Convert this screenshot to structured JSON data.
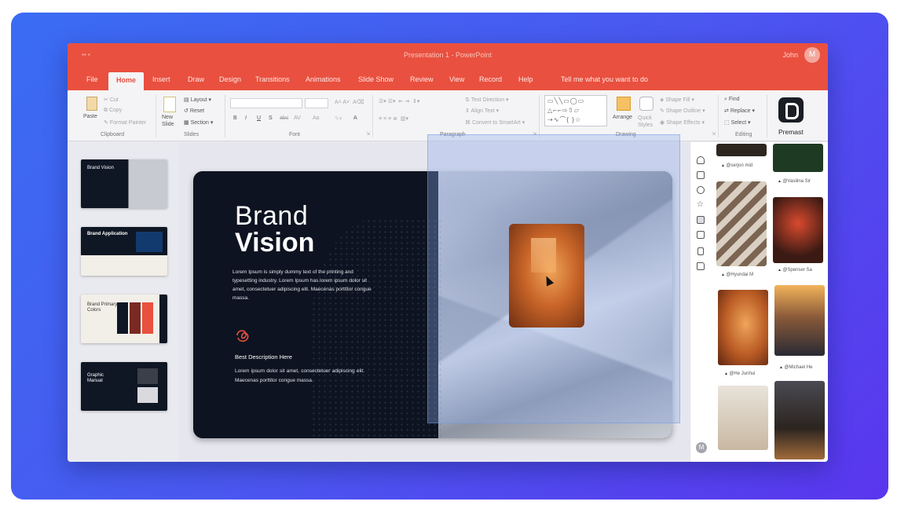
{
  "window": {
    "title": "Presentation 1 - PowerPoint",
    "user": "John",
    "user_initial": "M",
    "quick_access": "▪▪ ▪"
  },
  "tabs": [
    "File",
    "Home",
    "Insert",
    "Draw",
    "Design",
    "Transitions",
    "Animations",
    "Slide Show",
    "Review",
    "View",
    "Record",
    "Help",
    "Tell me what you want to do"
  ],
  "ribbon": {
    "clipboard": {
      "paste": "Paste",
      "cut": "Cut",
      "copy": "Copy",
      "format_painter": "Format Painter",
      "label": "Clipboard"
    },
    "slides": {
      "new_slide": "New Slide",
      "layout": "Layout",
      "reset": "Reset",
      "section": "Section",
      "label": "Slides"
    },
    "font": {
      "label": "Font",
      "buttons": [
        "B",
        "I",
        "U",
        "S",
        "abc",
        "AV",
        "Aa",
        "A"
      ]
    },
    "paragraph": {
      "label": "Paragraph",
      "text_direction": "Text Direction",
      "align_text": "Align Text",
      "smartart": "Convert to SmartArt"
    },
    "drawing": {
      "label": "Drawing",
      "arrange": "Arrange",
      "quick_styles": "Quick Styles",
      "shape_fill": "Shape Fill",
      "shape_outline": "Shape Outline",
      "shape_effects": "Shape Effects",
      "shapes_glyphs": "▭╲╲▭◯▭ △⌐⌐⇨⇧▱ ⇢∿⌒{ }☆"
    },
    "editing": {
      "label": "Editing",
      "find": "Find",
      "replace": "Replace",
      "select": "Select"
    },
    "addin": {
      "label": "Premast"
    }
  },
  "thumbnails": [
    {
      "title": "Brand Vision",
      "bg": "#0f1624"
    },
    {
      "title": "Brand Application",
      "bg": "#f2efe8"
    },
    {
      "title": "Brand Primary Colors",
      "bg": "#f2efe8"
    },
    {
      "title": "Graphic Manual",
      "bg": "#0f1624"
    }
  ],
  "slide": {
    "title_light": "Brand",
    "title_bold": "Vision",
    "body": "Lorem Ipsum is simply dummy text of the printing and typesetting industry. Lorem Ipsum has lorem ipsum dolor sit amet, consectetuer adipiscing elit. Maecenas porttitor congue massa.",
    "desc_title": "Best Description Here",
    "desc_body": "Lorem ipsum dolor sit amet, consectetuer adipiscing elit. Maecenas porttitor congue massa."
  },
  "rail_icons": [
    "home-icon",
    "layout-icon",
    "palette-icon",
    "star-icon",
    "image-icon",
    "sticky-note-icon",
    "save-icon",
    "folder-icon"
  ],
  "rail_avatar": "M",
  "image_panel": {
    "captions": [
      "@serjon mid",
      "@Vasilina Sir",
      "@Hyundai M",
      "@Spenser Sa",
      "@He Junhui",
      "@Michael He"
    ]
  },
  "colors": {
    "accent": "#e9503f",
    "slide_dark": "#0d1320",
    "background_gradient_start": "#3a6cf3",
    "background_gradient_end": "#5a36ee"
  }
}
